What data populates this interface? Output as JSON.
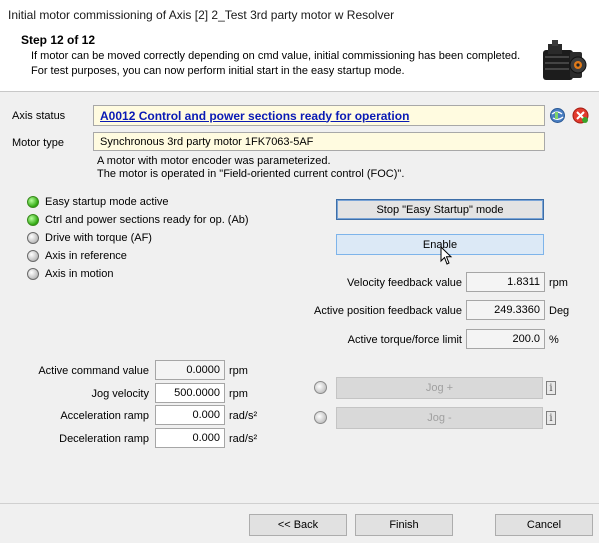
{
  "window": {
    "title": "Initial motor commissioning of Axis [2] 2_Test 3rd party motor w Resolver"
  },
  "header": {
    "step": "Step 12 of 12",
    "line1": "If motor can be moved correctly depending on cmd value, initial commissioning has been completed.",
    "line2": "For test purposes, you can now perform initial start in the easy startup mode."
  },
  "axis_status": {
    "label": "Axis status",
    "value": "A0012 Control and power sections ready for operation"
  },
  "motor_type": {
    "label": "Motor type",
    "value": "Synchronous 3rd party motor 1FK7063-5AF",
    "note1": "A motor with motor encoder was parameterized.",
    "note2": "The motor is operated in \"Field-oriented current control (FOC)\"."
  },
  "status_items": [
    {
      "label": "Easy startup mode active",
      "active": true
    },
    {
      "label": "Ctrl and power sections ready for op. (Ab)",
      "active": true
    },
    {
      "label": "Drive with torque (AF)",
      "active": false
    },
    {
      "label": "Axis in reference",
      "active": false
    },
    {
      "label": "Axis in motion",
      "active": false
    }
  ],
  "buttons": {
    "stop": "Stop \"Easy Startup\" mode",
    "enable": "Enable",
    "jog_plus": "Jog +",
    "jog_minus": "Jog -",
    "back": "<< Back",
    "finish": "Finish",
    "cancel": "Cancel"
  },
  "feedback": {
    "velocity": {
      "label": "Velocity feedback value",
      "value": "1.8311",
      "unit": "rpm"
    },
    "position": {
      "label": "Active position feedback value",
      "value": "249.3360",
      "unit": "Deg"
    },
    "torque": {
      "label": "Active torque/force limit",
      "value": "200.0",
      "unit": "%"
    }
  },
  "params": {
    "command": {
      "label": "Active command value",
      "value": "0.0000",
      "unit": "rpm"
    },
    "jog_velocity": {
      "label": "Jog velocity",
      "value": "500.0000",
      "unit": "rpm"
    },
    "accel": {
      "label": "Acceleration ramp",
      "value": "0.000",
      "unit": "rad/s²"
    },
    "decel": {
      "label": "Deceleration ramp",
      "value": "0.000",
      "unit": "rad/s²"
    }
  },
  "colors": {
    "led_on": "#2fa80f",
    "link": "#0a1ab5",
    "field_bg": "#fffbe0"
  },
  "icons": [
    "motor-image",
    "globe-refresh-icon",
    "error-close-icon",
    "info-icon",
    "mouse-cursor-icon"
  ]
}
